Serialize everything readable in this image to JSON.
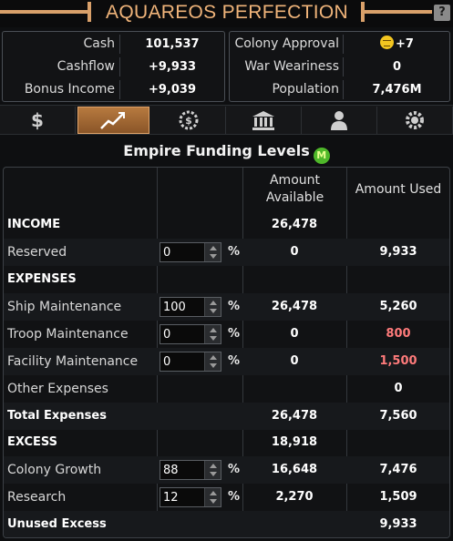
{
  "window": {
    "title": "AQUAREOS PERFECTION",
    "help_label": "?"
  },
  "summary_left": [
    {
      "label": "Cash",
      "value": "101,537"
    },
    {
      "label": "Cashflow",
      "value": "+9,933"
    },
    {
      "label": "Bonus Income",
      "value": "+9,039"
    }
  ],
  "summary_right": [
    {
      "label": "Colony Approval",
      "value": "+7",
      "icon": "neutral-face-icon"
    },
    {
      "label": "War Weariness",
      "value": "0"
    },
    {
      "label": "Population",
      "value": "7,476M"
    }
  ],
  "tabs": [
    {
      "icon": "dollar-icon",
      "active": false
    },
    {
      "icon": "trend-chart-icon",
      "active": true
    },
    {
      "icon": "coin-gear-icon",
      "active": false
    },
    {
      "icon": "government-building-icon",
      "active": false
    },
    {
      "icon": "person-icon",
      "active": false
    },
    {
      "icon": "gear-shield-icon",
      "active": false
    }
  ],
  "funding": {
    "title": "Empire Funding Levels",
    "badge": "M",
    "headers": {
      "available": "Amount Available",
      "used": "Amount Used"
    },
    "percent_sign": "%",
    "rows": [
      {
        "name": "INCOME",
        "bold": true,
        "available": "26,478",
        "used": ""
      },
      {
        "name": "Reserved",
        "spinner": "0",
        "available": "0",
        "used": "9,933"
      },
      {
        "name": "EXPENSES",
        "bold": true,
        "available": "",
        "used": ""
      },
      {
        "name": "Ship Maintenance",
        "spinner": "100",
        "available": "26,478",
        "used": "5,260"
      },
      {
        "name": "Troop Maintenance",
        "spinner": "0",
        "available": "0",
        "used": "800",
        "red": true
      },
      {
        "name": "Facility Maintenance",
        "spinner": "0",
        "available": "0",
        "used": "1,500",
        "red": true
      },
      {
        "name": "Other Expenses",
        "available": "",
        "used": "0"
      },
      {
        "name": "Total Expenses",
        "bold": true,
        "available": "26,478",
        "used": "7,560"
      },
      {
        "name": "EXCESS",
        "bold": true,
        "available": "18,918",
        "used": ""
      },
      {
        "name": "Colony Growth",
        "spinner": "88",
        "available": "16,648",
        "used": "7,476"
      },
      {
        "name": "Research",
        "spinner": "12",
        "available": "2,270",
        "used": "1,509"
      },
      {
        "name": "Unused Excess",
        "bold": true,
        "available": "",
        "used": "9,933"
      }
    ]
  },
  "colors": {
    "accent": "#d9a06a",
    "title": "#f0b47a",
    "negative": "#ff7b7b",
    "approval_face": "#f3c620",
    "badge": "#4fb82a"
  }
}
